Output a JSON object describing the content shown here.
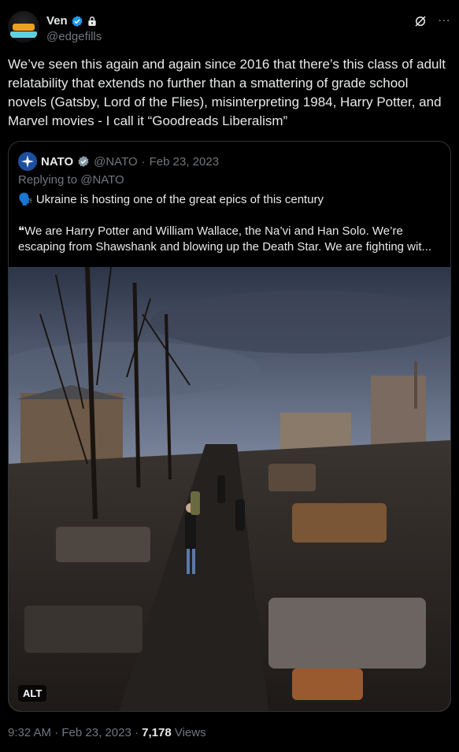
{
  "author": {
    "display_name": "Ven",
    "handle": "@edgefills"
  },
  "tweet": {
    "text": "We’ve seen this again and again since 2016 that there’s this class of adult relatability that extends no further than a smattering of grade school novels (Gatsby, Lord of the Flies), misinterpreting 1984, Harry Potter, and Marvel movies - I call it “Goodreads Liberalism”"
  },
  "quoted": {
    "display_name": "NATO",
    "handle": "@NATO",
    "separator": "·",
    "date": "Feb 23, 2023",
    "replying_to": "Replying to @NATO",
    "line1": "🗣️ Ukraine is hosting one of the great epics of this century",
    "line2": "❝We are Harry Potter and William Wallace, the Na’vi and Han Solo. We’re escaping from Shawshank and blowing up the Death Star. We are fighting wit...",
    "alt_label": "ALT"
  },
  "footer": {
    "time": "9:32 AM",
    "separator": "·",
    "date": "Feb 23, 2023",
    "views_count": "7,178",
    "views_label": "Views"
  },
  "colors": {
    "background": "#000000",
    "text": "#e7e9ea",
    "muted": "#71767b",
    "verified_blue": "#1d9bf0",
    "border": "#2f3336"
  },
  "icons": [
    "verified-badge-icon",
    "lock-icon",
    "grok-icon",
    "more-icon",
    "nato-logo-icon"
  ]
}
